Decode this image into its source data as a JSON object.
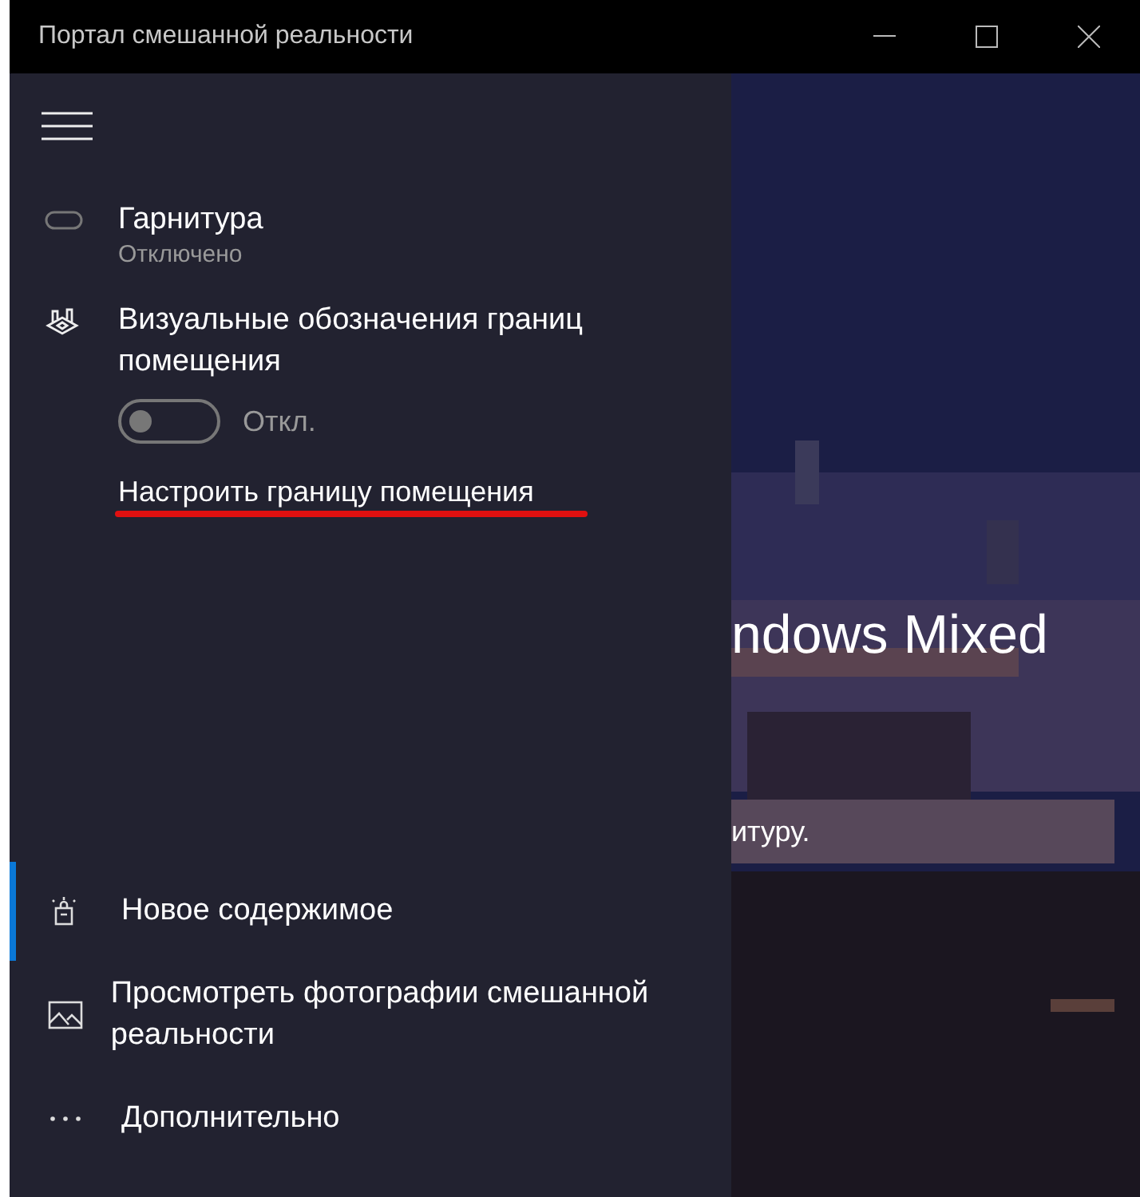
{
  "window": {
    "title": "Портал смешанной реальности"
  },
  "headset": {
    "title": "Гарнитура",
    "status": "Отключено"
  },
  "boundary": {
    "title": "Визуальные обозначения границ помещения",
    "toggle": {
      "on": false,
      "label": "Откл."
    },
    "link": "Настроить границу помещения"
  },
  "nav_items": [
    {
      "label": "Новое содержимое",
      "selected": true
    },
    {
      "label": "Просмотреть фотографии смешанной реальности",
      "selected": false
    },
    {
      "label": "Дополнительно",
      "selected": false
    }
  ],
  "background": {
    "heading": "ndows Mixed",
    "text": "итуру."
  }
}
